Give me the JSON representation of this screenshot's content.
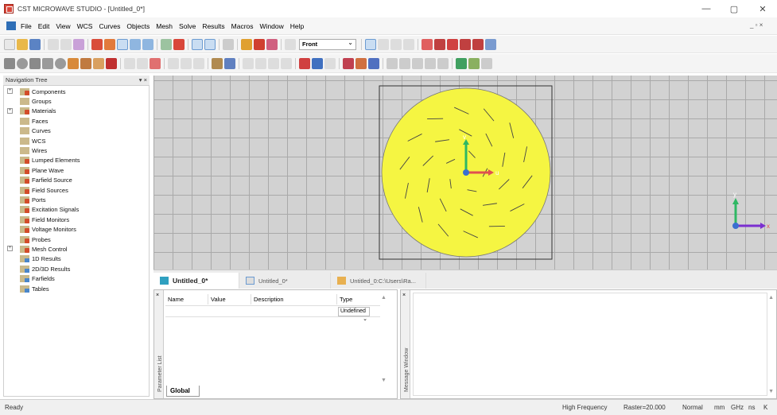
{
  "window": {
    "title": "CST MICROWAVE STUDIO - [Untitled_0*]",
    "minimize": "—",
    "restore": "▢",
    "close": "✕"
  },
  "menu": {
    "items": [
      "File",
      "Edit",
      "View",
      "WCS",
      "Curves",
      "Objects",
      "Mesh",
      "Solve",
      "Results",
      "Macros",
      "Window",
      "Help"
    ],
    "mdi_controls": "_ ▫ ×"
  },
  "toolbar": {
    "view_select": "Front"
  },
  "nav": {
    "header": "Navigation Tree",
    "close": "▾ ×",
    "items": [
      {
        "label": "Components",
        "icon": "red",
        "exp": "+"
      },
      {
        "label": "Groups",
        "icon": "plain",
        "exp": ""
      },
      {
        "label": "Materials",
        "icon": "red",
        "exp": "+"
      },
      {
        "label": "Faces",
        "icon": "plain",
        "exp": ""
      },
      {
        "label": "Curves",
        "icon": "plain",
        "exp": ""
      },
      {
        "label": "WCS",
        "icon": "plain",
        "exp": ""
      },
      {
        "label": "Wires",
        "icon": "plain",
        "exp": ""
      },
      {
        "label": "Lumped Elements",
        "icon": "red",
        "exp": ""
      },
      {
        "label": "Plane Wave",
        "icon": "red",
        "exp": ""
      },
      {
        "label": "Farfield Source",
        "icon": "red",
        "exp": ""
      },
      {
        "label": "Field Sources",
        "icon": "red",
        "exp": ""
      },
      {
        "label": "Ports",
        "icon": "red",
        "exp": ""
      },
      {
        "label": "Excitation Signals",
        "icon": "red",
        "exp": ""
      },
      {
        "label": "Field Monitors",
        "icon": "red",
        "exp": ""
      },
      {
        "label": "Voltage Monitors",
        "icon": "red",
        "exp": ""
      },
      {
        "label": "Probes",
        "icon": "red",
        "exp": ""
      },
      {
        "label": "Mesh Control",
        "icon": "red",
        "exp": "+"
      },
      {
        "label": "1D Results",
        "icon": "blue",
        "exp": ""
      },
      {
        "label": "2D/3D Results",
        "icon": "blue",
        "exp": ""
      },
      {
        "label": "Farfields",
        "icon": "blue",
        "exp": ""
      },
      {
        "label": "Tables",
        "icon": "blue",
        "exp": ""
      }
    ]
  },
  "viewport": {
    "axis_u": "u",
    "axis_v": "v",
    "axis_x": "x",
    "axis_y": "y",
    "colors": {
      "patch": "#f5f542",
      "background": "#d2d2d2",
      "grid": "#a9a9a9"
    }
  },
  "tabs": [
    {
      "label": "Untitled_0*",
      "active": true
    },
    {
      "label": "Untitled_0*",
      "active": false
    },
    {
      "label": "Untitled_0:C:\\Users\\Ra...",
      "active": false
    }
  ],
  "params": {
    "strip_label": "Parameter List",
    "headers": [
      "Name",
      "Value",
      "Description",
      "Type"
    ],
    "type_value": "Undefined",
    "global_tab": "Global"
  },
  "message": {
    "strip_label": "Message Window"
  },
  "status": {
    "left": "Ready",
    "mode": "High Frequency",
    "raster": "Raster=20.000",
    "view": "Normal",
    "units": [
      "mm",
      "GHz",
      "ns",
      "K"
    ]
  }
}
